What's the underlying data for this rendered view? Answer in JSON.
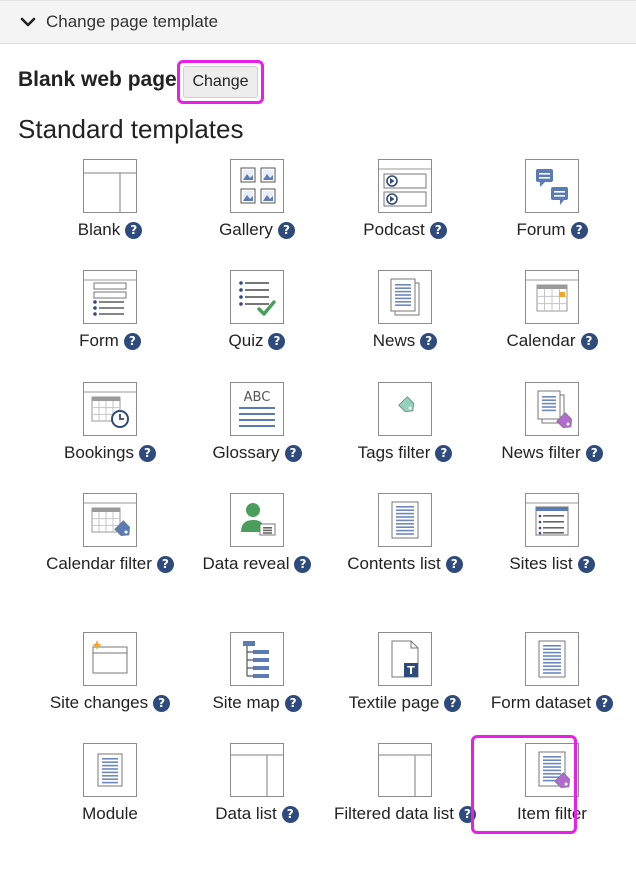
{
  "header": {
    "title": "Change page template"
  },
  "current_template": {
    "name": "Blank web page",
    "change_label": "Change"
  },
  "section_title": "Standard templates",
  "help_glyph": "?",
  "accent_color": "#2f4a7c",
  "highlight_color": "#e91ee9",
  "templates": [
    {
      "label": "Blank",
      "icon": "blank-template-icon",
      "help": true
    },
    {
      "label": "Gallery",
      "icon": "gallery-icon",
      "help": true
    },
    {
      "label": "Podcast",
      "icon": "podcast-icon",
      "help": true
    },
    {
      "label": "Forum",
      "icon": "forum-icon",
      "help": true
    },
    {
      "label": "Form",
      "icon": "form-icon",
      "help": true
    },
    {
      "label": "Quiz",
      "icon": "quiz-icon",
      "help": true
    },
    {
      "label": "News",
      "icon": "news-icon",
      "help": true
    },
    {
      "label": "Calendar",
      "icon": "calendar-icon",
      "help": true
    },
    {
      "label": "Bookings",
      "icon": "bookings-icon",
      "help": true
    },
    {
      "label": "Glossary",
      "icon": "glossary-icon",
      "help": true
    },
    {
      "label": "Tags filter",
      "icon": "tags-filter-icon",
      "help": true
    },
    {
      "label": "News filter",
      "icon": "news-filter-icon",
      "help": true
    },
    {
      "label": "Calendar filter",
      "icon": "calendar-filter-icon",
      "help": true
    },
    {
      "label": "Data reveal",
      "icon": "data-reveal-icon",
      "help": true
    },
    {
      "label": "Contents list",
      "icon": "contents-list-icon",
      "help": true
    },
    {
      "label": "Sites list",
      "icon": "sites-list-icon",
      "help": true
    },
    {
      "label": "Site changes",
      "icon": "site-changes-icon",
      "help": true
    },
    {
      "label": "Site map",
      "icon": "site-map-icon",
      "help": true
    },
    {
      "label": "Textile page",
      "icon": "textile-page-icon",
      "help": true
    },
    {
      "label": "Form dataset",
      "icon": "form-dataset-icon",
      "help": true
    },
    {
      "label": "Module",
      "icon": "module-icon",
      "help": false
    },
    {
      "label": "Data list",
      "icon": "data-list-icon",
      "help": true
    },
    {
      "label": "Filtered data list",
      "icon": "filtered-data-list-icon",
      "help": true
    },
    {
      "label": "Item filter",
      "icon": "item-filter-icon",
      "help": false
    }
  ]
}
